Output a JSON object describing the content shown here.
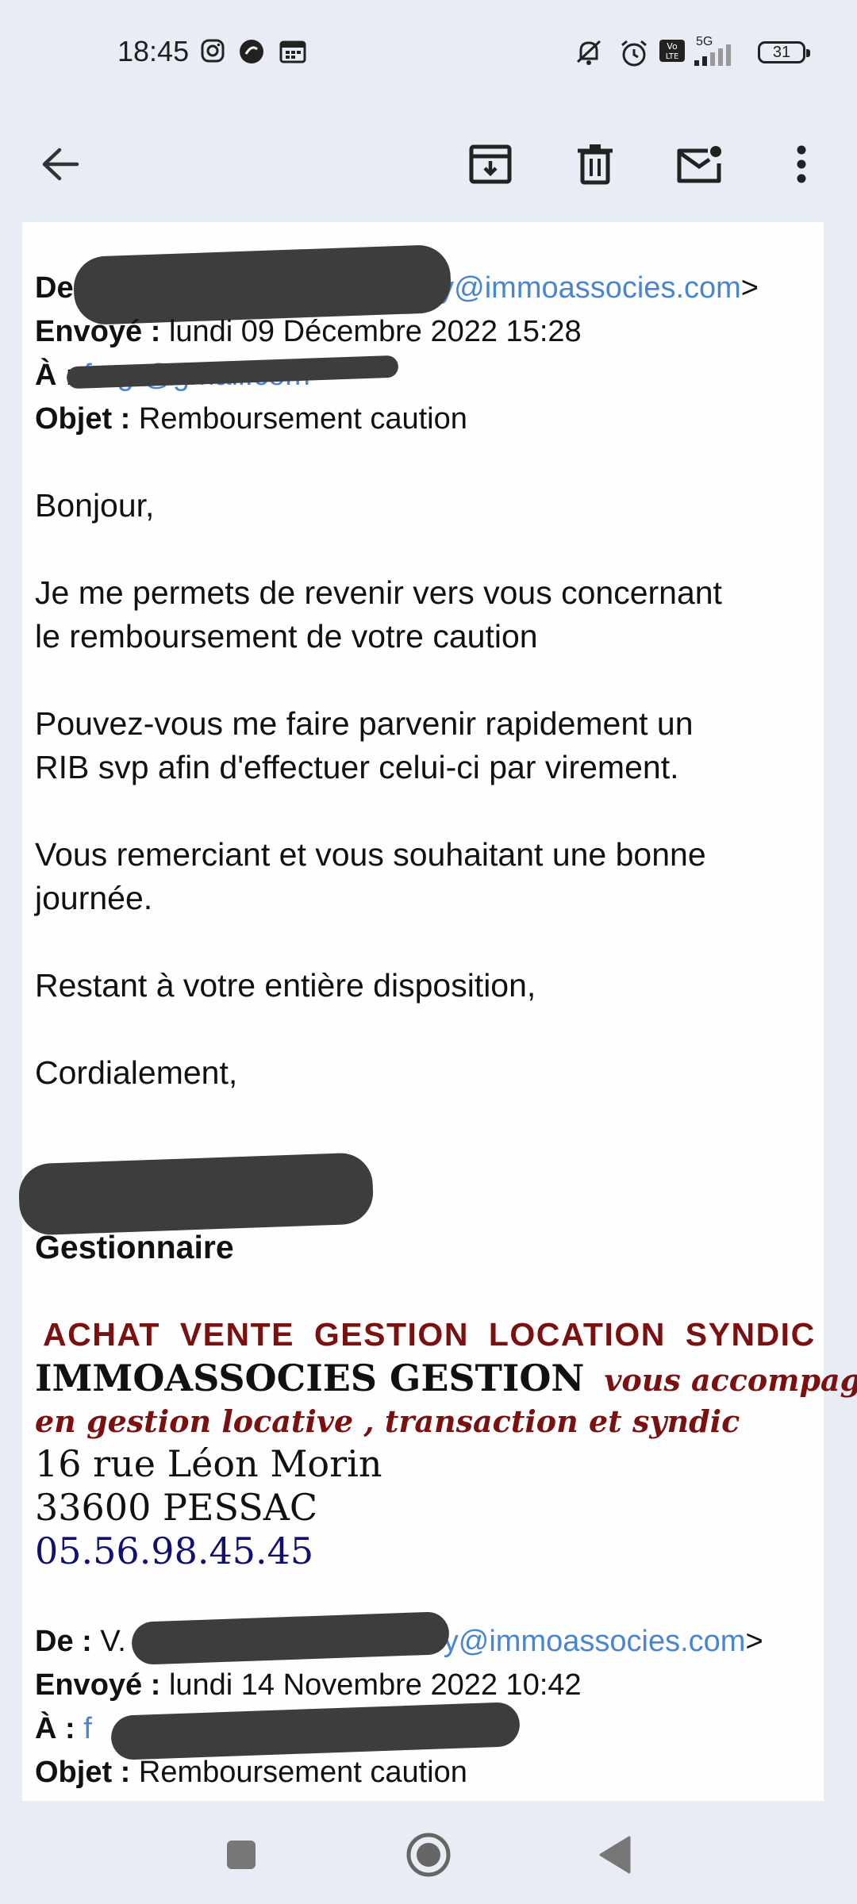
{
  "status": {
    "time": "18:45",
    "network": "5G",
    "battery": "31"
  },
  "appbar": {
    "icons": [
      "back-arrow-icon",
      "archive-icon",
      "delete-icon",
      "mark-unread-icon",
      "more-vert-icon"
    ]
  },
  "email": {
    "headers1": {
      "from_label": "De",
      "from_value": "y@immoassocies.com",
      "from_suffix": ">",
      "sent_label": "Envoyé :",
      "sent_value": "lundi 09 Décembre 2022 15:28",
      "to_label": "À :",
      "to_value": "fa       g       @gmail.com",
      "subject_label": "Objet :",
      "subject_value": "Remboursement caution"
    },
    "greeting": "Bonjour,",
    "para1_l1": "Je me permets de revenir vers vous concernant",
    "para1_l2": "le remboursement de votre caution",
    "para2_l1": "Pouvez-vous me faire parvenir rapidement un",
    "para2_l2": "RIB svp afin d'effectuer celui-ci par virement.",
    "para3_l1": "Vous remerciant et vous souhaitant une bonne",
    "para3_l2": "journée.",
    "para4": "Restant à votre entière disposition,",
    "closing": "Cordialement,",
    "signature": {
      "role": "Gestionnaire",
      "tagline": "ACHAT VENTE GESTION LOCATION SYNDIC",
      "company": "IMMOASSOCIES GESTION",
      "slogan_l1": "vous accompagne",
      "slogan_l2": "en gestion locative , transaction et syndic",
      "address1": "16 rue Léon Morin",
      "address2": "33600 PESSAC",
      "phone": "05.56.98.45.45"
    },
    "headers2": {
      "from_label": "De :",
      "from_initial": "V.",
      "from_value": "y@immoassocies.com",
      "from_suffix": ">",
      "sent_label": "Envoyé :",
      "sent_value": "lundi 14 Novembre 2022 10:42",
      "to_label": "À :",
      "to_value": "f",
      "subject_label": "Objet :",
      "subject_value": "Remboursement caution"
    }
  },
  "navbar": {
    "icons": [
      "recents-square-icon",
      "home-circle-icon",
      "back-triangle-icon"
    ]
  }
}
